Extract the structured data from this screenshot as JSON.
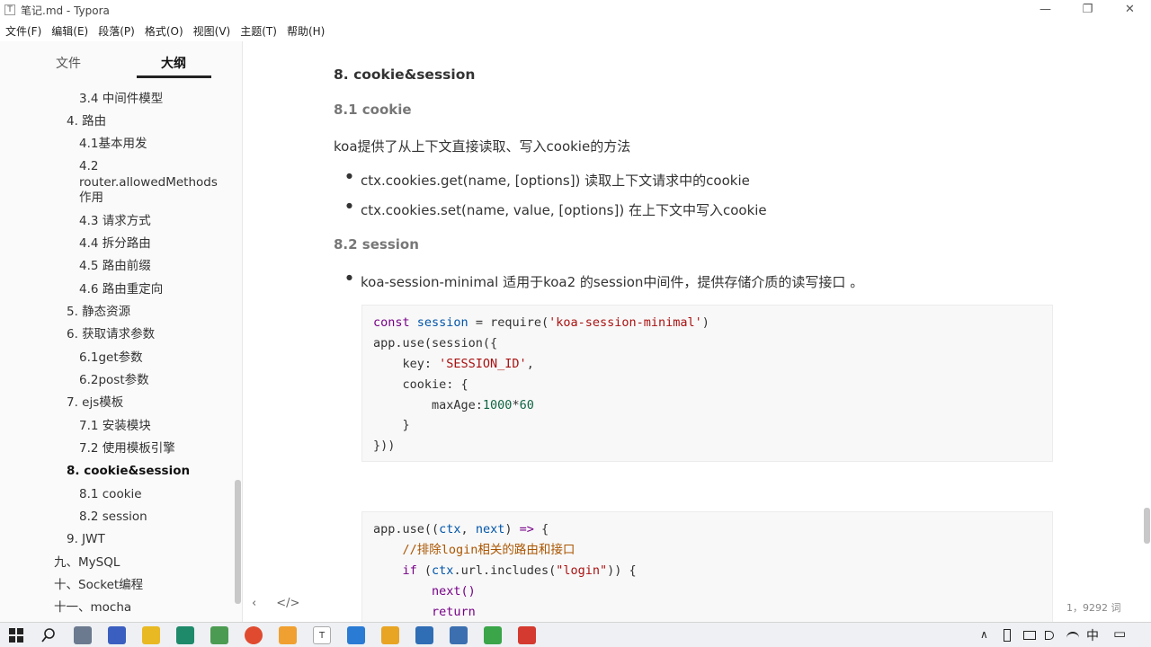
{
  "window": {
    "title": "笔记.md - Typora",
    "app_icon": "T",
    "minimize": "—",
    "restore": "❐",
    "close": "✕"
  },
  "menu": [
    "文件(F)",
    "编辑(E)",
    "段落(P)",
    "格式(O)",
    "视图(V)",
    "主题(T)",
    "帮助(H)"
  ],
  "sidebar": {
    "tabs": [
      "文件",
      "大纲"
    ],
    "active_tab": "大纲",
    "outline": [
      {
        "label": "3.4 中间件模型",
        "level": 2
      },
      {
        "label": "4. 路由",
        "level": 1
      },
      {
        "label": "4.1基本用发",
        "level": 2
      },
      {
        "label": "4.2",
        "level": 2
      },
      {
        "label": "router.allowedMethods",
        "level": 2
      },
      {
        "label": "作用",
        "level": 2
      },
      {
        "label": "4.3 请求方式",
        "level": 2
      },
      {
        "label": "4.4 拆分路由",
        "level": 2
      },
      {
        "label": "4.5 路由前缀",
        "level": 2
      },
      {
        "label": "4.6 路由重定向",
        "level": 2
      },
      {
        "label": "5. 静态资源",
        "level": 1
      },
      {
        "label": "6. 获取请求参数",
        "level": 1
      },
      {
        "label": "6.1get参数",
        "level": 2
      },
      {
        "label": "6.2post参数",
        "level": 2
      },
      {
        "label": "7. ejs模板",
        "level": 1
      },
      {
        "label": "7.1 安装模块",
        "level": 2
      },
      {
        "label": "7.2 使用模板引擎",
        "level": 2
      },
      {
        "label": "8. cookie&session",
        "level": 1,
        "active": true
      },
      {
        "label": "8.1 cookie",
        "level": 2
      },
      {
        "label": "8.2 session",
        "level": 2
      },
      {
        "label": "9. JWT",
        "level": 1
      },
      {
        "label": "九、MySQL",
        "level": 0
      },
      {
        "label": "十、Socket编程",
        "level": 0
      },
      {
        "label": "十一、mocha",
        "level": 0
      }
    ],
    "footer_left": "‹",
    "footer_code": "</>"
  },
  "doc": {
    "h2": "8. cookie&session",
    "h3_cookie": "8.1 cookie",
    "para_cookie": "koa提供了从上下文直接读取、写入cookie的方法",
    "bullet1": "ctx.cookies.get(name, [options]) 读取上下文请求中的cookie",
    "bullet2": "ctx.cookies.set(name, value, [options]) 在上下文中写入cookie",
    "h3_session": "8.2 session",
    "bullet3": "koa-session-minimal 适用于koa2 的session中间件，提供存储介质的读写接口 。"
  },
  "code1": {
    "l1_kw": "const",
    "l1_var": "session",
    "l1_eq": " = ",
    "l1_fn": "require(",
    "l1_str": "'koa-session-minimal'",
    "l1_end": ")",
    "l2": "app.use(session({",
    "l3_key": "    key: ",
    "l3_str": "'SESSION_ID'",
    "l3_end": ",",
    "l4": "    cookie: {",
    "l5_key": "        maxAge:",
    "l5_num": "1000",
    "l5_op": "*",
    "l5_num2": "60",
    "l6": "    }",
    "l7": "}))"
  },
  "code2": {
    "l1_a": "app.use((",
    "l1_v1": "ctx",
    "l1_b": ", ",
    "l1_v2": "next",
    "l1_c": ") ",
    "l1_arrow": "=>",
    "l1_d": " {",
    "l2": "    //排除login相关的路由和接口",
    "l3_kw": "if",
    "l3_a": " (",
    "l3_v": "ctx",
    "l3_b": ".url.includes(",
    "l3_str": "\"login\"",
    "l3_c": ")) {",
    "l4": "next()",
    "l5": "return"
  },
  "status": {
    "word_count": "1，9292 词"
  },
  "taskbar": {
    "tray_lang": "中",
    "tray_notify": "▭",
    "tray_up": "∧"
  }
}
